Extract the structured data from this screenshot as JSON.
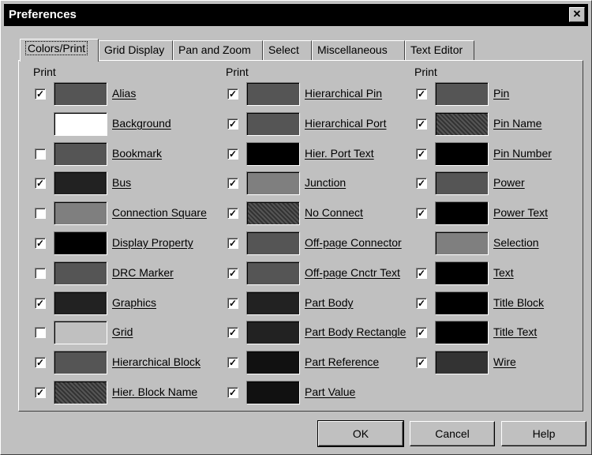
{
  "window": {
    "title": "Preferences",
    "close_glyph": "✕"
  },
  "tabs": [
    {
      "label": "Colors/Print",
      "active": true
    },
    {
      "label": "Grid Display"
    },
    {
      "label": "Pan and Zoom"
    },
    {
      "label": "Select"
    },
    {
      "label": "Miscellaneous"
    },
    {
      "label": "Text Editor"
    }
  ],
  "columns": [
    {
      "header": "Print",
      "items": [
        {
          "label": "Alias",
          "printable": true,
          "checked": true,
          "color": "#555555"
        },
        {
          "label": "Background",
          "printable": false,
          "checked": false,
          "color": "#ffffff"
        },
        {
          "label": "Bookmark",
          "printable": true,
          "checked": false,
          "color": "#555555"
        },
        {
          "label": "Bus",
          "printable": true,
          "checked": true,
          "color": "#222222"
        },
        {
          "label": "Connection Square",
          "printable": true,
          "checked": false,
          "color": "#7f7f7f"
        },
        {
          "label": "Display Property",
          "printable": true,
          "checked": true,
          "color": "#000000"
        },
        {
          "label": "DRC Marker",
          "printable": true,
          "checked": false,
          "color": "#555555"
        },
        {
          "label": "Graphics",
          "printable": true,
          "checked": true,
          "color": "#222222"
        },
        {
          "label": "Grid",
          "printable": true,
          "checked": false,
          "color": "#c0c0c0"
        },
        {
          "label": "Hierarchical Block",
          "printable": true,
          "checked": true,
          "color": "#555555"
        },
        {
          "label": "Hier. Block Name",
          "printable": true,
          "checked": true,
          "color": "#555555",
          "dither": true
        }
      ]
    },
    {
      "header": "Print",
      "items": [
        {
          "label": "Hierarchical Pin",
          "printable": true,
          "checked": true,
          "color": "#555555"
        },
        {
          "label": "Hierarchical Port",
          "printable": true,
          "checked": true,
          "color": "#555555"
        },
        {
          "label": "Hier. Port Text",
          "printable": true,
          "checked": true,
          "color": "#000000"
        },
        {
          "label": "Junction",
          "printable": true,
          "checked": true,
          "color": "#7f7f7f"
        },
        {
          "label": "No Connect",
          "printable": true,
          "checked": true,
          "color": "#666666",
          "dither": true
        },
        {
          "label": "Off-page Connector",
          "printable": true,
          "checked": true,
          "color": "#555555"
        },
        {
          "label": "Off-page Cnctr Text",
          "printable": true,
          "checked": true,
          "color": "#555555"
        },
        {
          "label": "Part Body",
          "printable": true,
          "checked": true,
          "color": "#222222"
        },
        {
          "label": "Part Body Rectangle",
          "printable": true,
          "checked": true,
          "color": "#222222"
        },
        {
          "label": "Part Reference",
          "printable": true,
          "checked": true,
          "color": "#111111"
        },
        {
          "label": "Part Value",
          "printable": true,
          "checked": true,
          "color": "#111111"
        }
      ]
    },
    {
      "header": "Print",
      "items": [
        {
          "label": "Pin",
          "printable": true,
          "checked": true,
          "color": "#555555"
        },
        {
          "label": "Pin Name",
          "printable": true,
          "checked": true,
          "color": "#555555",
          "dither": true
        },
        {
          "label": "Pin Number",
          "printable": true,
          "checked": true,
          "color": "#000000"
        },
        {
          "label": "Power",
          "printable": true,
          "checked": true,
          "color": "#555555"
        },
        {
          "label": "Power Text",
          "printable": true,
          "checked": true,
          "color": "#000000"
        },
        {
          "label": "Selection",
          "printable": false,
          "checked": false,
          "color": "#7f7f7f"
        },
        {
          "label": "Text",
          "printable": true,
          "checked": true,
          "color": "#000000"
        },
        {
          "label": "Title Block",
          "printable": true,
          "checked": true,
          "color": "#000000"
        },
        {
          "label": "Title Text",
          "printable": true,
          "checked": true,
          "color": "#000000"
        },
        {
          "label": "Wire",
          "printable": true,
          "checked": true,
          "color": "#333333"
        }
      ]
    }
  ],
  "buttons": {
    "ok": "OK",
    "cancel": "Cancel",
    "help": "Help"
  },
  "check_glyph": "✓"
}
